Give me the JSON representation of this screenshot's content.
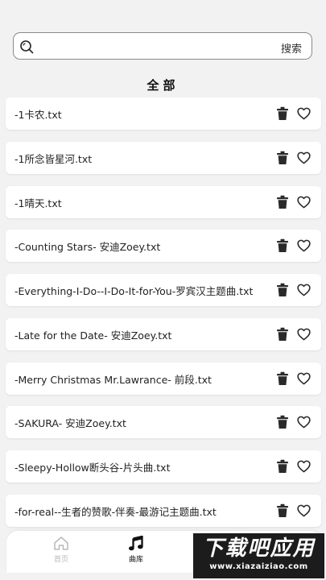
{
  "search": {
    "placeholder": "",
    "button_label": "搜索"
  },
  "section_title": "全部",
  "files": [
    "-1卡农.txt",
    "-1所念皆星河.txt",
    "-1晴天.txt",
    "-Counting Stars- 安迪Zoey.txt",
    "-Everything-I-Do--I-Do-It-for-You-罗宾汉主题曲.txt",
    "-Late for the Date- 安迪Zoey.txt",
    "-Merry Christmas Mr.Lawrance- 前段.txt",
    "-SAKURA- 安迪Zoey.txt",
    "-Sleepy-Hollow断头谷-片头曲.txt",
    "-for-real--生者的赞歌-伴奏-最游记主题曲.txt"
  ],
  "nav": {
    "home_label": "首页",
    "library_label": "曲库"
  },
  "watermark": {
    "title": "下载吧应用",
    "url": "www.xiazaiziao.com"
  },
  "colors": {
    "background": "#f2f2f2",
    "card": "#ffffff",
    "icon": "#2a2a2a",
    "nav_inactive": "#b9b9b9"
  }
}
